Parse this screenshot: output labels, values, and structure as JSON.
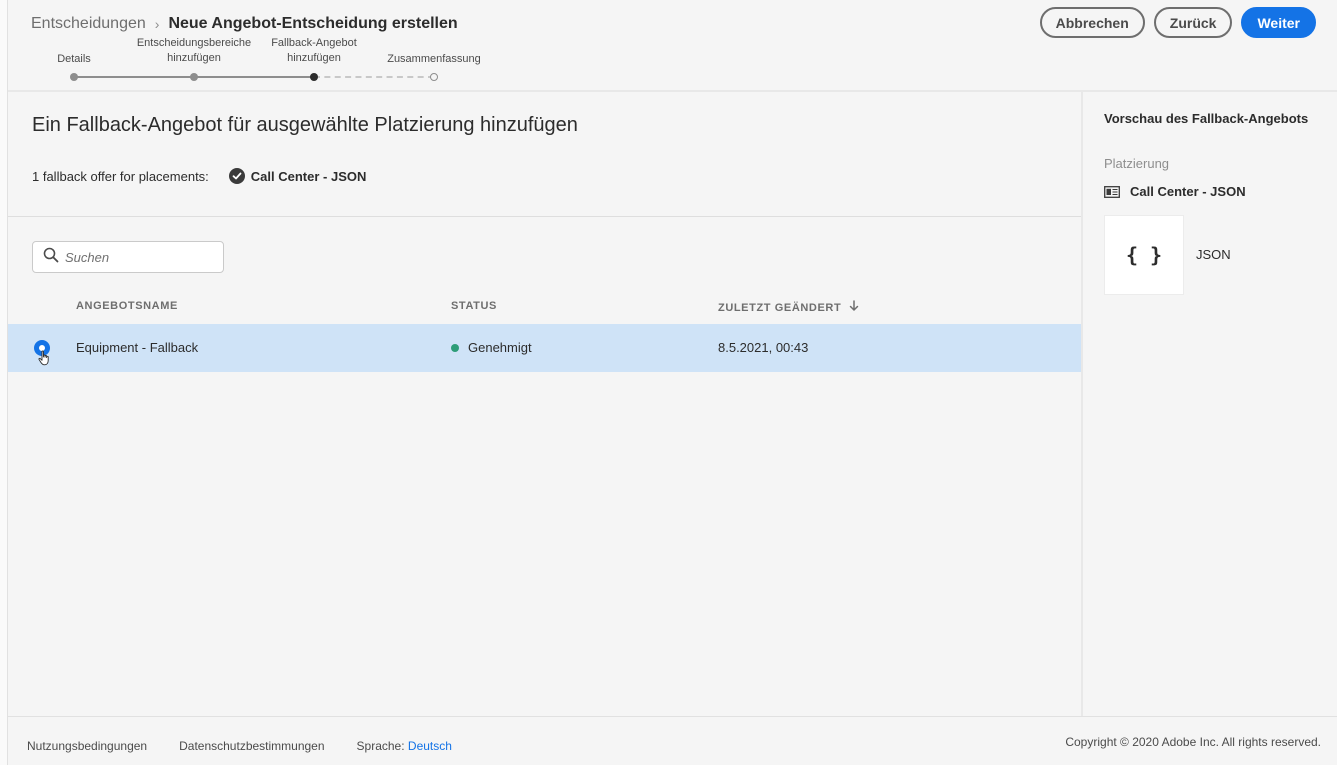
{
  "breadcrumb": {
    "root": "Entscheidungen",
    "separator": "›",
    "current": "Neue Angebot-Entscheidung erstellen"
  },
  "stepper": {
    "steps": [
      {
        "label": "Details",
        "state": "completed"
      },
      {
        "label": "Entscheidungsbereiche hinzufügen",
        "state": "completed"
      },
      {
        "label": "Fallback-Angebot hinzufügen",
        "state": "current"
      },
      {
        "label": "Zusammenfassung",
        "state": "pending"
      }
    ]
  },
  "header_buttons": {
    "cancel": "Abbrechen",
    "back": "Zurück",
    "next": "Weiter"
  },
  "main": {
    "title": "Ein Fallback-Angebot für ausgewählte Platzierung hinzufügen",
    "placements_label": "1 fallback offer for placements:",
    "placement_chip": "Call Center - JSON",
    "search": {
      "placeholder": "Suchen",
      "value": ""
    },
    "table": {
      "columns": {
        "name": "ANGEBOTSNAME",
        "status": "STATUS",
        "modified": "ZULETZT GEÄNDERT"
      },
      "sort_direction": "descending",
      "rows": [
        {
          "name": "Equipment - Fallback",
          "status": "Genehmigt",
          "modified": "8.5.2021, 00:43",
          "selected": true
        }
      ]
    }
  },
  "panel": {
    "title": "Vorschau des Fallback-Angebots",
    "placement_label": "Platzierung",
    "placement_name": "Call Center - JSON",
    "content_icon": "{ }",
    "content_type": "JSON"
  },
  "footer": {
    "terms": "Nutzungsbedingungen",
    "privacy": "Datenschutzbestimmungen",
    "language_label": "Sprache:",
    "language_value": "Deutsch",
    "copyright": "Copyright © 2020 Adobe Inc. All rights reserved."
  },
  "colors": {
    "accent": "#1473e6",
    "selected_row": "#cfe3f7",
    "status_approved": "#2d9d78"
  },
  "icons": [
    "chevron-right-icon",
    "checkmark-circle-icon",
    "search-icon",
    "arrow-down-sort-icon",
    "radio-selected-icon",
    "hand-cursor-icon",
    "placement-icon"
  ]
}
